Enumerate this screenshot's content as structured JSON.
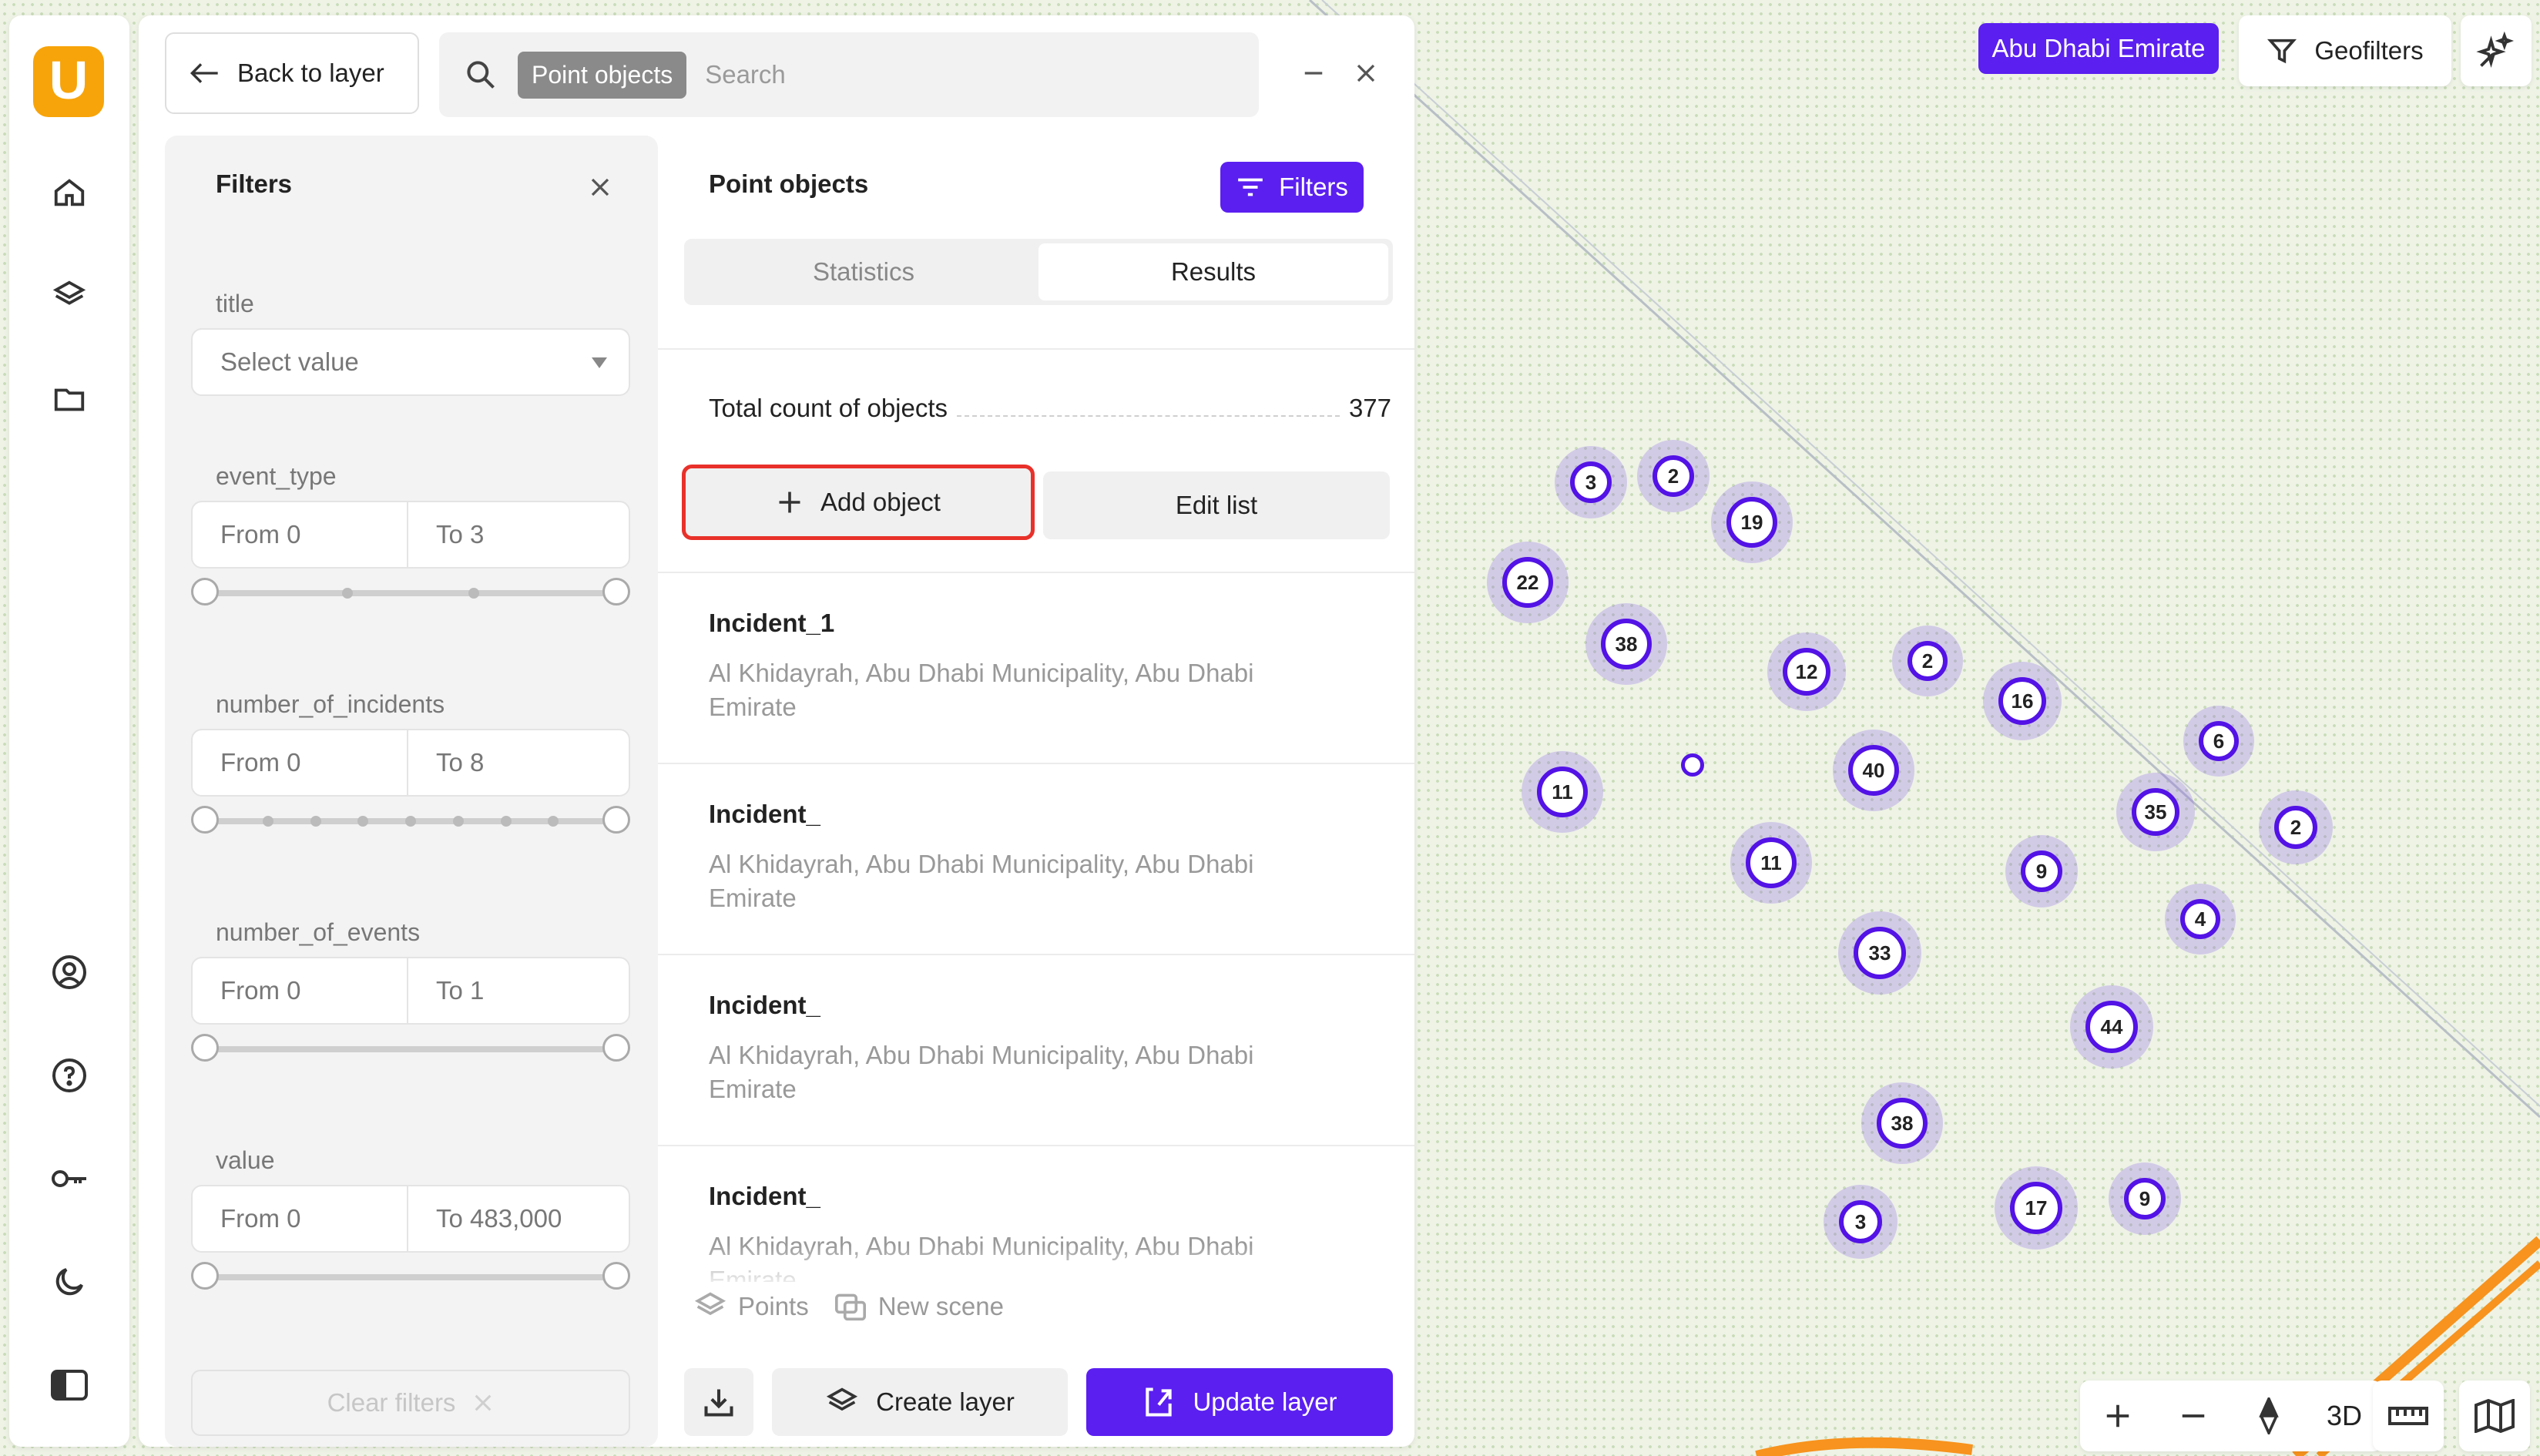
{
  "sidebar": {
    "logo_letter": "U",
    "icons": [
      "home-icon",
      "layers-icon",
      "folder-icon",
      "user-circle-icon",
      "help-icon",
      "key-icon",
      "moon-icon",
      "panel-toggle-icon"
    ]
  },
  "panel": {
    "back_label": "Back to layer",
    "search_chip": "Point objects",
    "search_placeholder": "Search"
  },
  "filters": {
    "title": "Filters",
    "fields": [
      {
        "label": "title",
        "type": "select",
        "placeholder": "Select value"
      },
      {
        "label": "event_type",
        "type": "range",
        "from": "From 0",
        "to": "To 3",
        "ticks": 2
      },
      {
        "label": "number_of_incidents",
        "type": "range",
        "from": "From 0",
        "to": "To 8",
        "ticks": 7
      },
      {
        "label": "number_of_events",
        "type": "range",
        "from": "From 0",
        "to": "To 1",
        "ticks": 0
      },
      {
        "label": "value",
        "type": "range",
        "from": "From 0",
        "to": "To 483,000",
        "ticks": 0
      }
    ],
    "clear_label": "Clear filters"
  },
  "results": {
    "title": "Point objects",
    "filters_button": "Filters",
    "tabs": [
      {
        "label": "Statistics",
        "active": false
      },
      {
        "label": "Results",
        "active": true
      }
    ],
    "total_label": "Total count of objects",
    "total_value": "377",
    "add_object": "Add object",
    "edit_list": "Edit list",
    "items": [
      {
        "name": "Incident_1",
        "address": "Al Khidayrah, Abu Dhabi Municipality, Abu Dhabi Emirate"
      },
      {
        "name": "Incident_",
        "address": "Al Khidayrah, Abu Dhabi Municipality, Abu Dhabi Emirate"
      },
      {
        "name": "Incident_",
        "address": "Al Khidayrah, Abu Dhabi Municipality, Abu Dhabi Emirate"
      },
      {
        "name": "Incident_",
        "address": "Al Khidayrah, Abu Dhabi Municipality, Abu Dhabi Emirate"
      }
    ],
    "footer_layer": "Points",
    "footer_scene": "New scene",
    "create_layer": "Create layer",
    "update_layer": "Update layer"
  },
  "map": {
    "region": "Abu Dhabi Emirate",
    "geofilters": "Geofilters",
    "mode_3d": "3D",
    "clusters": [
      "3",
      "2",
      "19",
      "22",
      "38",
      "12",
      "2",
      "16",
      "6",
      "11",
      "",
      "40",
      "35",
      "2",
      "11",
      "9",
      "4",
      "33",
      "44",
      "38",
      "3",
      "17",
      "9"
    ]
  },
  "colors": {
    "accent": "#5b1ff0",
    "logo": "#f7a40a",
    "cluster_stroke": "#5312e6",
    "highlight": "#e8312a",
    "road": "#f7931e"
  }
}
